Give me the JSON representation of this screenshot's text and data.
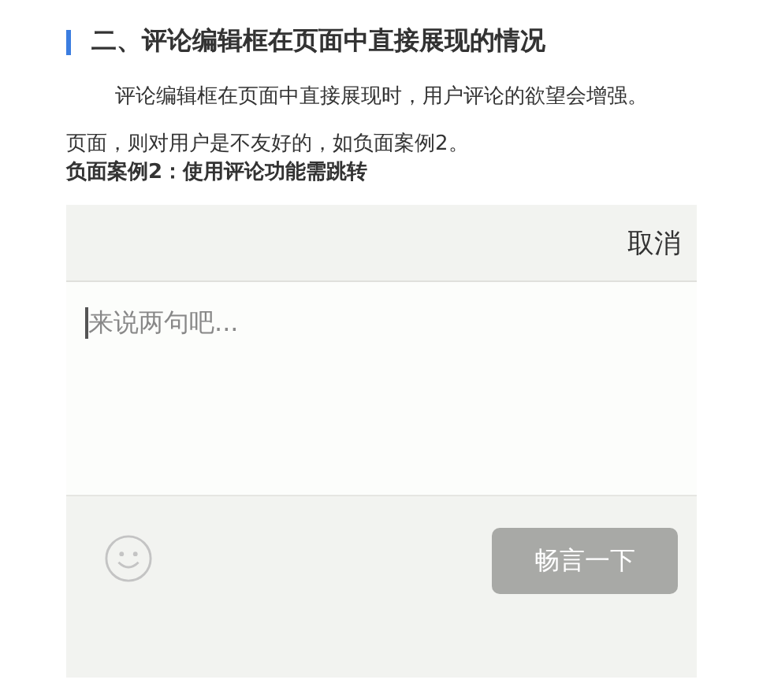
{
  "heading": "二、评论编辑框在页面中直接展现的情况",
  "paragraph_lines": [
    "评论编辑框在页面中直接展现时，用户评论的欲望会增强。",
    "页面，则对用户是不友好的，如负面案例2。"
  ],
  "caption": "负面案例2：使用评论功能需跳转",
  "comment_box": {
    "cancel": "取消",
    "placeholder": "来说两句吧...",
    "submit": {
      "label": "畅言一下",
      "disabled": true
    }
  }
}
